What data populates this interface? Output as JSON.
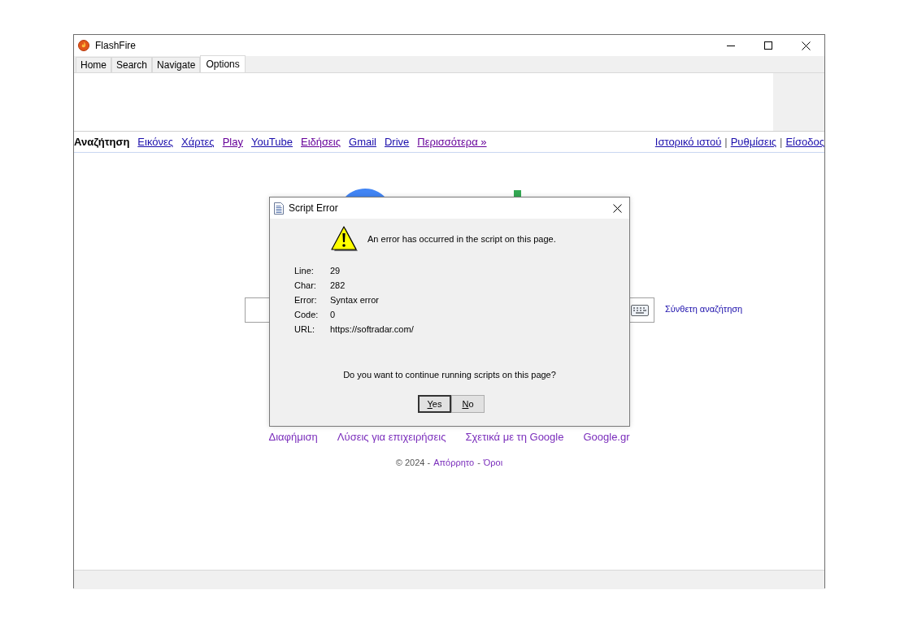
{
  "window": {
    "title": "FlashFire"
  },
  "tabs": [
    {
      "label": "Home",
      "selected": false
    },
    {
      "label": "Search",
      "selected": false
    },
    {
      "label": "Navigate",
      "selected": false
    },
    {
      "label": "Options",
      "selected": true
    }
  ],
  "google_bar": {
    "left_links": [
      {
        "label": "Αναζήτηση",
        "selected": true,
        "visited": false
      },
      {
        "label": "Εικόνες",
        "selected": false,
        "visited": false
      },
      {
        "label": "Χάρτες",
        "selected": false,
        "visited": false
      },
      {
        "label": "Play",
        "selected": false,
        "visited": true
      },
      {
        "label": "YouTube",
        "selected": false,
        "visited": false
      },
      {
        "label": "Ειδήσεις",
        "selected": false,
        "visited": true
      },
      {
        "label": "Gmail",
        "selected": false,
        "visited": false
      },
      {
        "label": "Drive",
        "selected": false,
        "visited": false
      },
      {
        "label": "Περισσότερα »",
        "selected": false,
        "visited": true
      }
    ],
    "right_links": [
      "Ιστορικό ιστού",
      "Ρυθμίσεις",
      "Είσοδος"
    ],
    "separator": "|"
  },
  "search": {
    "advanced_link": "Σύνθετη αναζήτηση"
  },
  "footer_links": [
    "Διαφήμιση",
    "Λύσεις για επιχειρήσεις",
    "Σχετικά με τη Google",
    "Google.gr"
  ],
  "copyright": [
    {
      "kind": "text",
      "text": "© 2024 -"
    },
    {
      "kind": "link",
      "text": "Απόρρητο"
    },
    {
      "kind": "text",
      "text": "-"
    },
    {
      "kind": "link",
      "text": "Όροι"
    }
  ],
  "dialog": {
    "title": "Script Error",
    "message": "An error has occurred in the script on this page.",
    "details": [
      {
        "label": "Line:",
        "value": "29"
      },
      {
        "label": "Char:",
        "value": "282"
      },
      {
        "label": "Error:",
        "value": "Syntax error"
      },
      {
        "label": "Code:",
        "value": "0"
      },
      {
        "label": "URL:",
        "value": "https://softradar.com/"
      }
    ],
    "question": "Do you want to continue running scripts on this page?",
    "buttons": [
      {
        "label": "Yes",
        "selected": true
      },
      {
        "label": "No",
        "selected": false
      }
    ]
  }
}
